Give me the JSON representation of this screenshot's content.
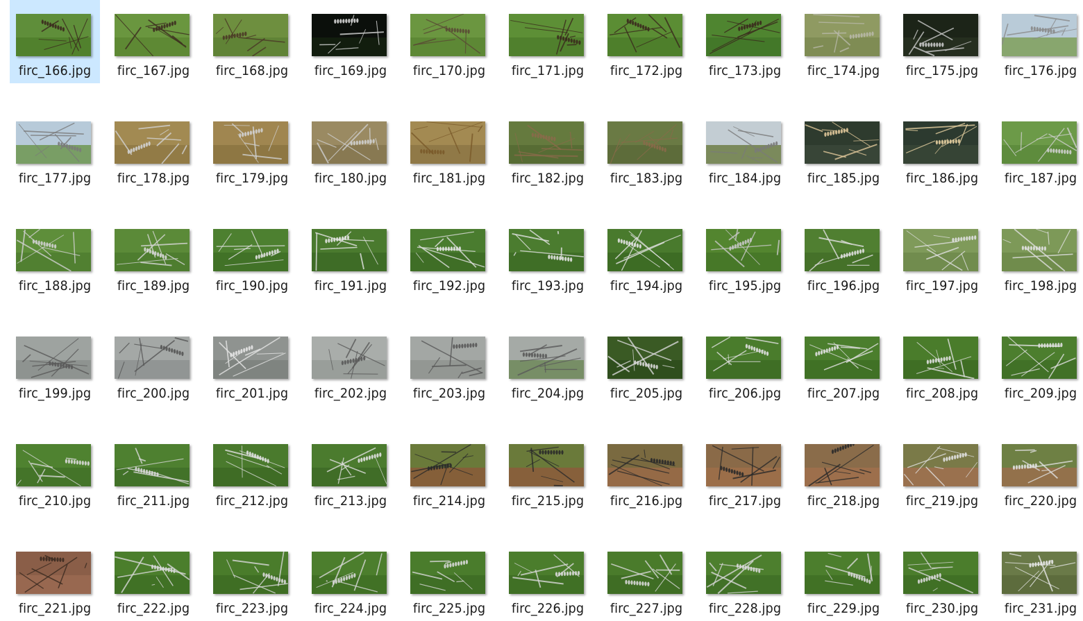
{
  "window": {
    "view": "Large icons"
  },
  "selected_index": 0,
  "files": [
    {
      "name": "firc_166.jpg",
      "bg": "#5f8e3a",
      "ground": "#4f7f2c",
      "line": "#3b2a1e"
    },
    {
      "name": "firc_167.jpg",
      "bg": "#6a963f",
      "ground": "#5c8733",
      "line": "#3d2d20"
    },
    {
      "name": "firc_168.jpg",
      "bg": "#6e8f3f",
      "ground": "#5e8135",
      "line": "#4a3826"
    },
    {
      "name": "firc_169.jpg",
      "bg": "#0b0f0b",
      "ground": "#14200f",
      "line": "#d6d6d6"
    },
    {
      "name": "firc_170.jpg",
      "bg": "#6b9640",
      "ground": "#5b8634",
      "line": "#5a4a35"
    },
    {
      "name": "firc_171.jpg",
      "bg": "#5d8f36",
      "ground": "#4e7e2c",
      "line": "#3a2a1d"
    },
    {
      "name": "firc_172.jpg",
      "bg": "#5b8d34",
      "ground": "#4c7d2a",
      "line": "#3a2a1d"
    },
    {
      "name": "firc_173.jpg",
      "bg": "#4f8530",
      "ground": "#417528",
      "line": "#3a2a1d"
    },
    {
      "name": "firc_174.jpg",
      "bg": "#8f9a62",
      "ground": "#7d8a52",
      "line": "#b8b8a8"
    },
    {
      "name": "firc_175.jpg",
      "bg": "#1c2418",
      "ground": "#273021",
      "line": "#c9c9c9"
    },
    {
      "name": "firc_176.jpg",
      "bg": "#b9cbd8",
      "ground": "#7fa05c",
      "line": "#8a8a8a"
    },
    {
      "name": "firc_177.jpg",
      "bg": "#b7cad9",
      "ground": "#6f9650",
      "line": "#7a7a7a"
    },
    {
      "name": "firc_178.jpg",
      "bg": "#a28a52",
      "ground": "#8f7844",
      "line": "#d2d2d2"
    },
    {
      "name": "firc_179.jpg",
      "bg": "#a08650",
      "ground": "#8b7441",
      "line": "#d0d0d0"
    },
    {
      "name": "firc_180.jpg",
      "bg": "#9a8a62",
      "ground": "#857550",
      "line": "#cfcfcf"
    },
    {
      "name": "firc_181.jpg",
      "bg": "#a38a52",
      "ground": "#8d7645",
      "line": "#7a5a2a"
    },
    {
      "name": "firc_182.jpg",
      "bg": "#657a3e",
      "ground": "#556a32",
      "line": "#8a6a4a"
    },
    {
      "name": "firc_183.jpg",
      "bg": "#6a7a44",
      "ground": "#5a6a38",
      "line": "#8a6a4a"
    },
    {
      "name": "firc_184.jpg",
      "bg": "#c3cdd3",
      "ground": "#6e7e46",
      "line": "#7a7a7a"
    },
    {
      "name": "firc_185.jpg",
      "bg": "#2e3b2e",
      "ground": "#3a4838",
      "line": "#e0c89a"
    },
    {
      "name": "firc_186.jpg",
      "bg": "#2c3a2f",
      "ground": "#384636",
      "line": "#e4cfa0"
    },
    {
      "name": "firc_187.jpg",
      "bg": "#6c9a48",
      "ground": "#5c8a3c",
      "line": "#d0d0d0"
    },
    {
      "name": "firc_188.jpg",
      "bg": "#5e8e3a",
      "ground": "#4f7e30",
      "line": "#d0d0d0"
    },
    {
      "name": "firc_189.jpg",
      "bg": "#5b8a38",
      "ground": "#4c7a2e",
      "line": "#d8d8d8"
    },
    {
      "name": "firc_190.jpg",
      "bg": "#4d8030",
      "ground": "#3f7026",
      "line": "#e0e0e0"
    },
    {
      "name": "firc_191.jpg",
      "bg": "#4a7a2e",
      "ground": "#3c6a24",
      "line": "#e4e4e4"
    },
    {
      "name": "firc_192.jpg",
      "bg": "#4a7c2f",
      "ground": "#3d6c25",
      "line": "#e2e2e2"
    },
    {
      "name": "firc_193.jpg",
      "bg": "#4b7c2f",
      "ground": "#3d6c25",
      "line": "#e2e2e2"
    },
    {
      "name": "firc_194.jpg",
      "bg": "#497a2d",
      "ground": "#3b6a23",
      "line": "#e2e2e2"
    },
    {
      "name": "firc_195.jpg",
      "bg": "#53852f",
      "ground": "#457527",
      "line": "#c8c8c8"
    },
    {
      "name": "firc_196.jpg",
      "bg": "#507f31",
      "ground": "#436f28",
      "line": "#e0e0e0"
    },
    {
      "name": "firc_197.jpg",
      "bg": "#7f9a5a",
      "ground": "#6f8a4c",
      "line": "#e0e0e0"
    },
    {
      "name": "firc_198.jpg",
      "bg": "#7d9958",
      "ground": "#6d894a",
      "line": "#e0e0e0"
    },
    {
      "name": "firc_199.jpg",
      "bg": "#9ea3a0",
      "ground": "#8b918d",
      "line": "#5a5a5a"
    },
    {
      "name": "firc_200.jpg",
      "bg": "#a4a8a6",
      "ground": "#8e9290",
      "line": "#555555"
    },
    {
      "name": "firc_201.jpg",
      "bg": "#8f9390",
      "ground": "#7d817e",
      "line": "#e6e6e6"
    },
    {
      "name": "firc_202.jpg",
      "bg": "#a9adaa",
      "ground": "#979b98",
      "line": "#5a5a5a"
    },
    {
      "name": "firc_203.jpg",
      "bg": "#a3a7a4",
      "ground": "#909491",
      "line": "#585858"
    },
    {
      "name": "firc_204.jpg",
      "bg": "#a5aaa6",
      "ground": "#6f8a5a",
      "line": "#5a5a5a"
    },
    {
      "name": "firc_205.jpg",
      "bg": "#3a5a24",
      "ground": "#2e4c1c",
      "line": "#d8d8d8"
    },
    {
      "name": "firc_206.jpg",
      "bg": "#4a7c2c",
      "ground": "#3d6c24",
      "line": "#e0e0e0"
    },
    {
      "name": "firc_207.jpg",
      "bg": "#4b7e2d",
      "ground": "#3e6e25",
      "line": "#e0e0e0"
    },
    {
      "name": "firc_208.jpg",
      "bg": "#4a7c2b",
      "ground": "#3d6c23",
      "line": "#e0e0e0"
    },
    {
      "name": "firc_209.jpg",
      "bg": "#4c7e2e",
      "ground": "#3f6e26",
      "line": "#e0e0e0"
    },
    {
      "name": "firc_210.jpg",
      "bg": "#4f8230",
      "ground": "#427228",
      "line": "#d8d8d8"
    },
    {
      "name": "firc_211.jpg",
      "bg": "#4e8030",
      "ground": "#417028",
      "line": "#d8d8d8"
    },
    {
      "name": "firc_212.jpg",
      "bg": "#4a7a2d",
      "ground": "#3d6a25",
      "line": "#e0e0e0"
    },
    {
      "name": "firc_213.jpg",
      "bg": "#4b7b2e",
      "ground": "#3e6b26",
      "line": "#e0e0e0"
    },
    {
      "name": "firc_214.jpg",
      "bg": "#6a7a3a",
      "ground": "#8a5a3a",
      "line": "#2a2a2a"
    },
    {
      "name": "firc_215.jpg",
      "bg": "#6a7a3a",
      "ground": "#8c5c3c",
      "line": "#2a2a2a"
    },
    {
      "name": "firc_216.jpg",
      "bg": "#7a6a40",
      "ground": "#9a6a48",
      "line": "#2a2a2a"
    },
    {
      "name": "firc_217.jpg",
      "bg": "#8a6a48",
      "ground": "#9e6e4a",
      "line": "#2a2a2a"
    },
    {
      "name": "firc_218.jpg",
      "bg": "#8a6c4a",
      "ground": "#a0704c",
      "line": "#2a2a2a"
    },
    {
      "name": "firc_219.jpg",
      "bg": "#7a7a48",
      "ground": "#a07050",
      "line": "#e0e0e0"
    },
    {
      "name": "firc_220.jpg",
      "bg": "#6e8044",
      "ground": "#9a6e4c",
      "line": "#e0e0e0"
    },
    {
      "name": "firc_221.jpg",
      "bg": "#8a5e48",
      "ground": "#9a6a52",
      "line": "#3a2a20"
    },
    {
      "name": "firc_222.jpg",
      "bg": "#4b7e2c",
      "ground": "#3e6e24",
      "line": "#d8d8d8"
    },
    {
      "name": "firc_223.jpg",
      "bg": "#4a7c2b",
      "ground": "#3d6c23",
      "line": "#d8d8d8"
    },
    {
      "name": "firc_224.jpg",
      "bg": "#4c7e2d",
      "ground": "#3f6e25",
      "line": "#d8d8d8"
    },
    {
      "name": "firc_225.jpg",
      "bg": "#4a7c2c",
      "ground": "#3d6c24",
      "line": "#d8d8d8"
    },
    {
      "name": "firc_226.jpg",
      "bg": "#4b7d2c",
      "ground": "#3e6d24",
      "line": "#d8d8d8"
    },
    {
      "name": "firc_227.jpg",
      "bg": "#4a7b2b",
      "ground": "#3d6b23",
      "line": "#d8d8d8"
    },
    {
      "name": "firc_228.jpg",
      "bg": "#4d7f2e",
      "ground": "#406f26",
      "line": "#d8d8d8"
    },
    {
      "name": "firc_229.jpg",
      "bg": "#4c7e2d",
      "ground": "#3f6e25",
      "line": "#d8d8d8"
    },
    {
      "name": "firc_230.jpg",
      "bg": "#4b7d2c",
      "ground": "#3e6d24",
      "line": "#d8d8d8"
    },
    {
      "name": "firc_231.jpg",
      "bg": "#6a7a48",
      "ground": "#5a6a3c",
      "line": "#e8e8e8"
    }
  ]
}
